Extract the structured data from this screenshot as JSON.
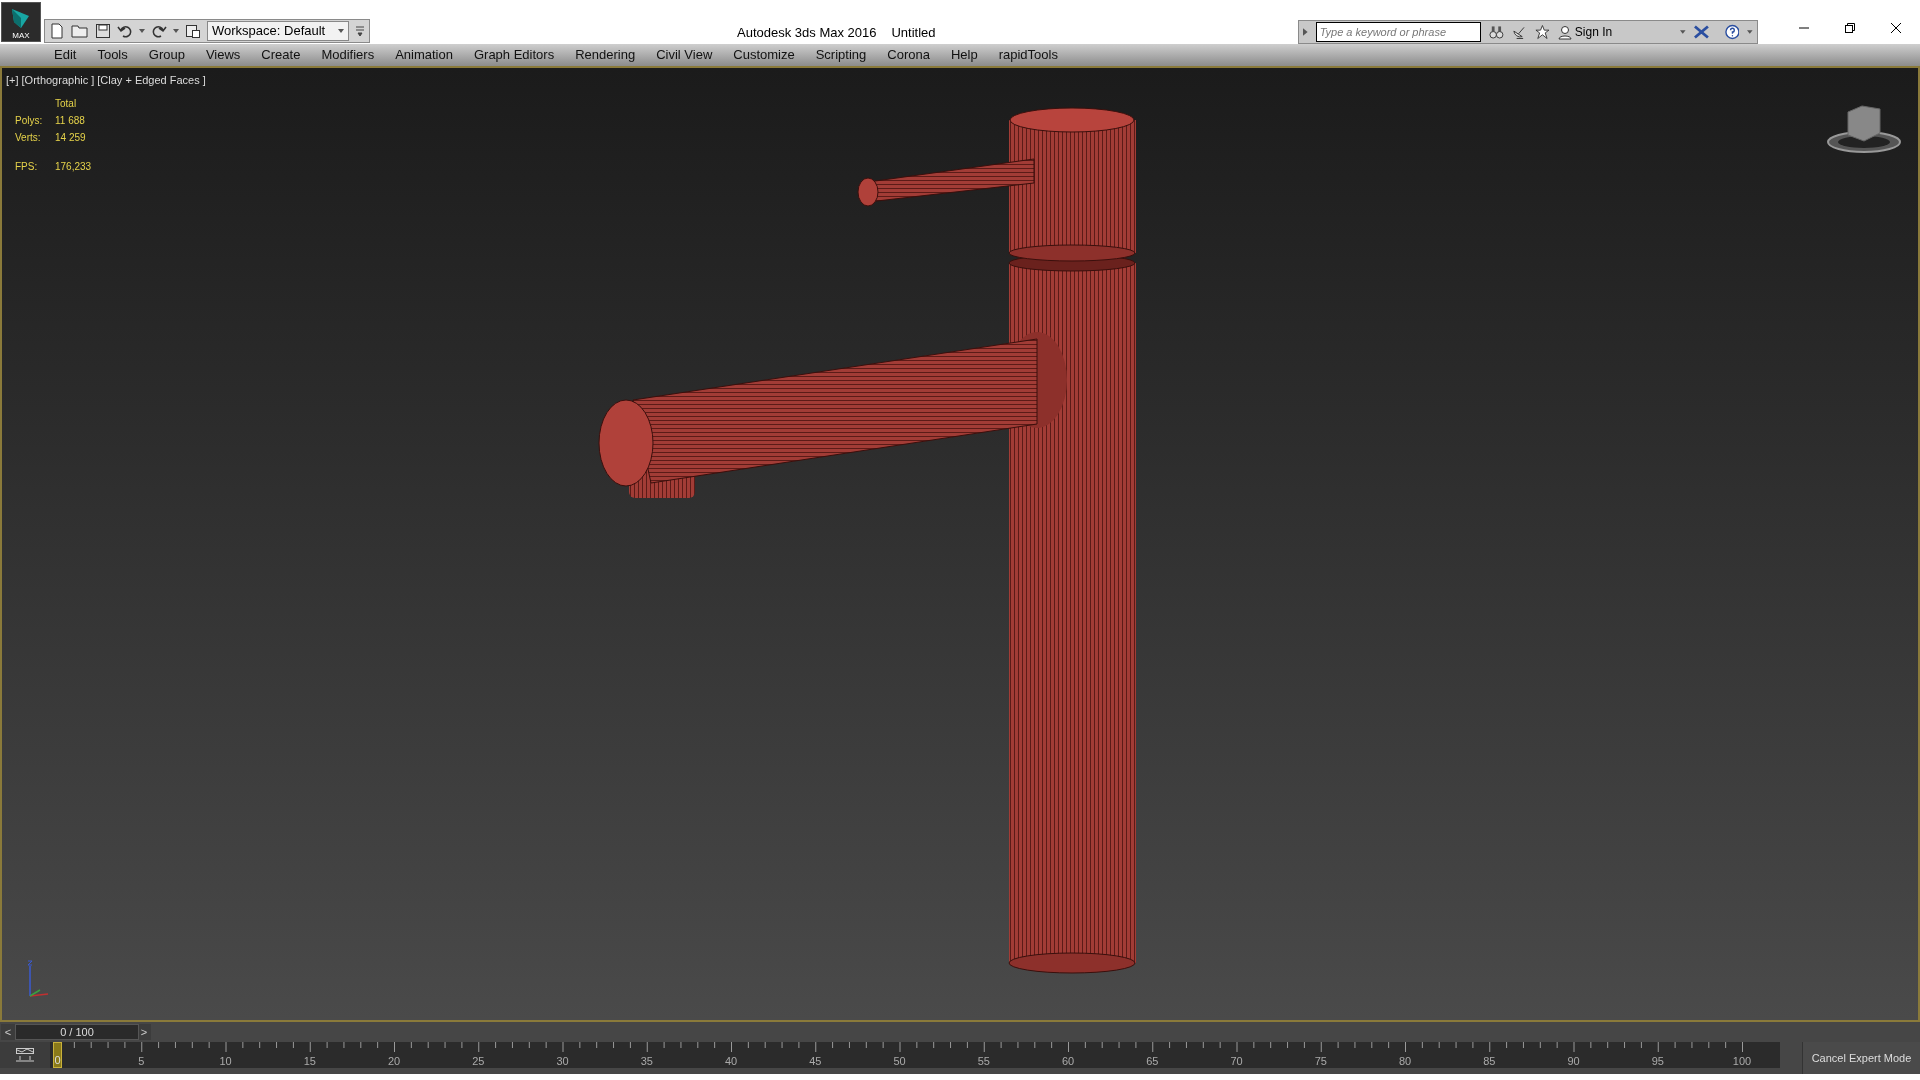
{
  "title_bar": {
    "logo": "MAX",
    "workspace": "Workspace: Default",
    "app_title": "Autodesk 3ds Max 2016",
    "document": "Untitled",
    "search": {
      "placeholder": "Type a keyword or phrase"
    },
    "sign_in": "Sign In"
  },
  "menu": [
    "Edit",
    "Tools",
    "Group",
    "Views",
    "Create",
    "Modifiers",
    "Animation",
    "Graph Editors",
    "Rendering",
    "Civil View",
    "Customize",
    "Scripting",
    "Corona",
    "Help",
    "rapidTools"
  ],
  "viewport": {
    "labels": [
      "[+]",
      "[Orthographic ]",
      "[Clay + Edged Faces ]"
    ],
    "stats": {
      "header": "Total",
      "rows": [
        {
          "label": "Polys:",
          "value": "11 688"
        },
        {
          "label": "Verts:",
          "value": "14 259"
        }
      ],
      "fps": {
        "label": "FPS:",
        "value": "176,233"
      }
    }
  },
  "time_slider": {
    "prev": "<",
    "frame": "0 / 100",
    "next": ">",
    "level": 0
  },
  "track_bar": {
    "labels": [
      "0",
      "5",
      "10",
      "15",
      "20",
      "25",
      "30",
      "35",
      "40",
      "45",
      "50",
      "55",
      "60",
      "65",
      "70",
      "75",
      "80",
      "85",
      "90",
      "95",
      "100"
    ]
  },
  "expert_button": "Cancel Expert Mode"
}
